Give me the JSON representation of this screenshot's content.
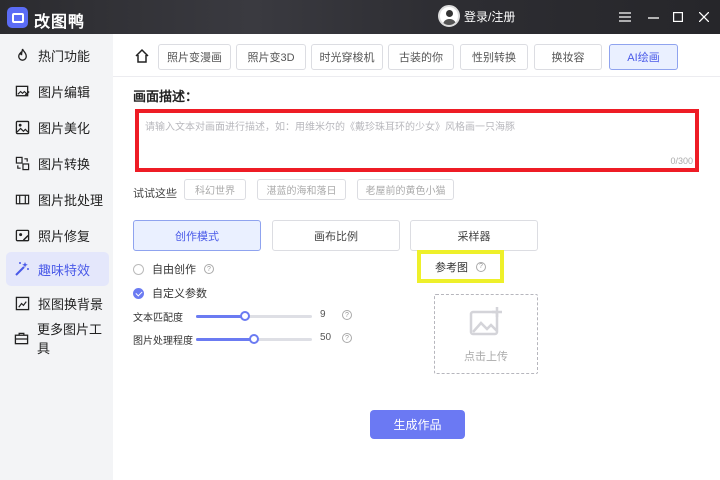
{
  "app": {
    "title": "改图鸭"
  },
  "header": {
    "login_label": "登录/注册",
    "window_controls": [
      "menu-icon",
      "minimize-icon",
      "maximize-icon",
      "close-icon"
    ]
  },
  "sidebar": {
    "items": [
      {
        "label": "热门功能",
        "icon": "flame-icon",
        "active": false
      },
      {
        "label": "图片编辑",
        "icon": "image-edit-icon",
        "active": false
      },
      {
        "label": "图片美化",
        "icon": "image-beautify-icon",
        "active": false
      },
      {
        "label": "图片转换",
        "icon": "convert-icon",
        "active": false
      },
      {
        "label": "图片批处理",
        "icon": "batch-icon",
        "active": false
      },
      {
        "label": "照片修复",
        "icon": "photo-repair-icon",
        "active": false
      },
      {
        "label": "趣味特效",
        "icon": "magic-wand-icon",
        "active": true
      },
      {
        "label": "抠图换背景",
        "icon": "cutout-icon",
        "active": false
      },
      {
        "label": "更多图片工具",
        "icon": "toolbox-icon",
        "active": false
      }
    ]
  },
  "tabs": [
    {
      "label": "照片变漫画",
      "active": false
    },
    {
      "label": "照片变3D",
      "active": false
    },
    {
      "label": "时光穿梭机",
      "active": false
    },
    {
      "label": "古装的你",
      "active": false
    },
    {
      "label": "性别转换",
      "active": false
    },
    {
      "label": "换妆容",
      "active": false
    },
    {
      "label": "AI绘画",
      "active": true
    }
  ],
  "main": {
    "desc_title": "画面描述：",
    "desc_placeholder": "请输入文本对画面进行描述，如：用维米尔的《戴珍珠耳环的少女》风格画一只海豚",
    "desc_count": "0/300",
    "try_label": "试试这些",
    "try_chips": [
      "科幻世界",
      "湛蓝的海和落日",
      "老屋前的黄色小猫"
    ],
    "mode_tabs": [
      {
        "label": "创作模式",
        "active": true
      },
      {
        "label": "画布比例",
        "active": false
      },
      {
        "label": "采样器",
        "active": false
      }
    ],
    "radio_free": "自由创作",
    "radio_custom": "自定义参数",
    "sliders": [
      {
        "label": "文本匹配度",
        "value": "9",
        "fraction": 0.42
      },
      {
        "label": "图片处理程度",
        "value": "50",
        "fraction": 0.5
      }
    ],
    "ref_label": "参考图",
    "upload_label": "点击上传",
    "generate_label": "生成作品"
  },
  "colors": {
    "accent": "#6b79f3",
    "highlight_red": "#ee1c25",
    "highlight_yellow": "#eef02a"
  }
}
